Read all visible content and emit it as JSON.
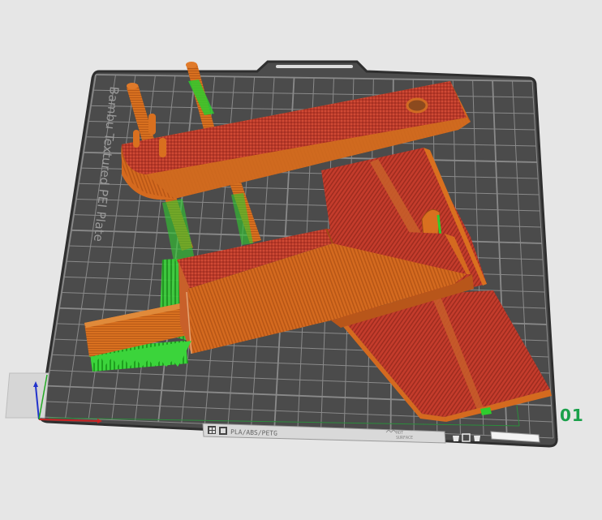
{
  "plate": {
    "brand_text": "Bambu Textured PEI Plate",
    "filament_label": "PLA/ABS/PETG",
    "temp_label": "HOT",
    "temp_sublabel": "SURFACE",
    "number": "01"
  },
  "colors": {
    "background": "#e6e6e6",
    "plate": "#4b4b4b",
    "plate_edge": "#2f2f2f",
    "grid": "#8a8a8a",
    "part_top": "#c65a1e",
    "part_side": "#d9701f",
    "part_face_red": "#c0392b",
    "support": "#2ecc2e",
    "plate_number": "#1aa04a"
  },
  "icons": {
    "plate_tools": [
      "grid-icon",
      "copy-icon"
    ],
    "plate_actions": [
      "bucket-icon",
      "square-icon",
      "bucket-icon"
    ]
  }
}
